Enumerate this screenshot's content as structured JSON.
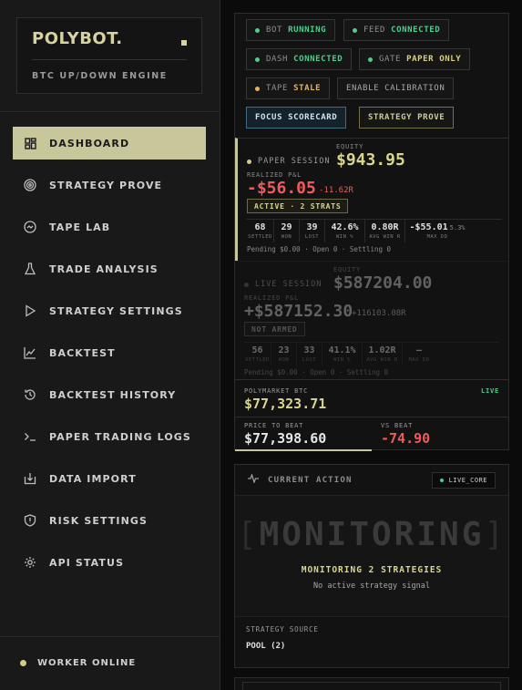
{
  "brand": {
    "title": "POLYBOT.",
    "subtitle": "BTC UP/DOWN ENGINE"
  },
  "nav": [
    {
      "label": "DASHBOARD",
      "icon": "dashboard-icon",
      "active": true
    },
    {
      "label": "STRATEGY PROVE",
      "icon": "target-icon"
    },
    {
      "label": "TAPE LAB",
      "icon": "tape-icon"
    },
    {
      "label": "TRADE ANALYSIS",
      "icon": "flask-icon"
    },
    {
      "label": "STRATEGY SETTINGS",
      "icon": "play-icon"
    },
    {
      "label": "BACKTEST",
      "icon": "line-chart-icon"
    },
    {
      "label": "BACKTEST HISTORY",
      "icon": "history-icon"
    },
    {
      "label": "PAPER TRADING LOGS",
      "icon": "terminal-icon"
    },
    {
      "label": "DATA IMPORT",
      "icon": "import-icon"
    },
    {
      "label": "RISK SETTINGS",
      "icon": "shield-icon"
    },
    {
      "label": "API STATUS",
      "icon": "gear-icon"
    }
  ],
  "worker": {
    "label": "WORKER ONLINE"
  },
  "status": {
    "bot": {
      "label": "BOT",
      "value": "RUNNING"
    },
    "feed": {
      "label": "FEED",
      "value": "CONNECTED"
    },
    "dash": {
      "label": "DASH",
      "value": "CONNECTED"
    },
    "gate": {
      "label": "GATE",
      "value": "PAPER ONLY"
    },
    "tape": {
      "label": "TAPE",
      "value": "STALE"
    },
    "calibration": "ENABLE CALIBRATION",
    "focus": "FOCUS SCORECARD",
    "prove": "STRATEGY PROVE"
  },
  "paper": {
    "tag": "PAPER SESSION",
    "equity_label": "EQUITY",
    "equity": "$943.95",
    "pnl_label": "REALIZED P&L",
    "pnl": "-$56.05",
    "pnl_r": "-11.62R",
    "badge": "ACTIVE · 2 STRATS",
    "stats": [
      {
        "v": "68",
        "l": "SETTLED",
        "c": "white"
      },
      {
        "v": "29",
        "l": "WON",
        "c": "green"
      },
      {
        "v": "39",
        "l": "LOST",
        "c": "red"
      },
      {
        "v": "42.6%",
        "l": "WIN %",
        "c": "green"
      },
      {
        "v": "0.80R",
        "l": "AVG WIN R",
        "c": "green"
      },
      {
        "v": "-$55.01",
        "s": "5.3%",
        "l": "MAX DD",
        "c": "red"
      }
    ],
    "pending": "Pending $0.00 · Open 0 · Settling 0"
  },
  "live": {
    "tag": "LIVE SESSION",
    "equity_label": "EQUITY",
    "equity": "$587204.00",
    "pnl_label": "REALIZED P&L",
    "pnl": "+$587152.30",
    "pnl_r": "+116103.08R",
    "badge": "NOT ARMED",
    "stats": [
      {
        "v": "56",
        "l": "SETTLED"
      },
      {
        "v": "23",
        "l": "WON"
      },
      {
        "v": "33",
        "l": "LOST"
      },
      {
        "v": "41.1%",
        "l": "WIN %"
      },
      {
        "v": "1.02R",
        "l": "AVG WIN R"
      },
      {
        "v": "—",
        "l": "MAX DD"
      }
    ],
    "pending": "Pending $0.00 · Open 0 · Settling 0"
  },
  "btc": {
    "label": "POLYMARKET BTC",
    "live": "LIVE",
    "price": "$77,323.71",
    "beat_label": "PRICE TO BEAT",
    "beat": "$77,398.60",
    "vs_label": "VS BEAT",
    "vs": "-74.90"
  },
  "action": {
    "title": "CURRENT ACTION",
    "core": "LIVE_CORE",
    "state": "MONITORING",
    "sub": "MONITORING 2 STRATEGIES",
    "signal": "No active strategy signal",
    "source_label": "STRATEGY SOURCE",
    "source": "POOL (2)"
  },
  "colors": {
    "accent": "#c8c79b",
    "green": "#49d08a",
    "red": "#ef5b5b",
    "orange": "#e5b45a"
  }
}
